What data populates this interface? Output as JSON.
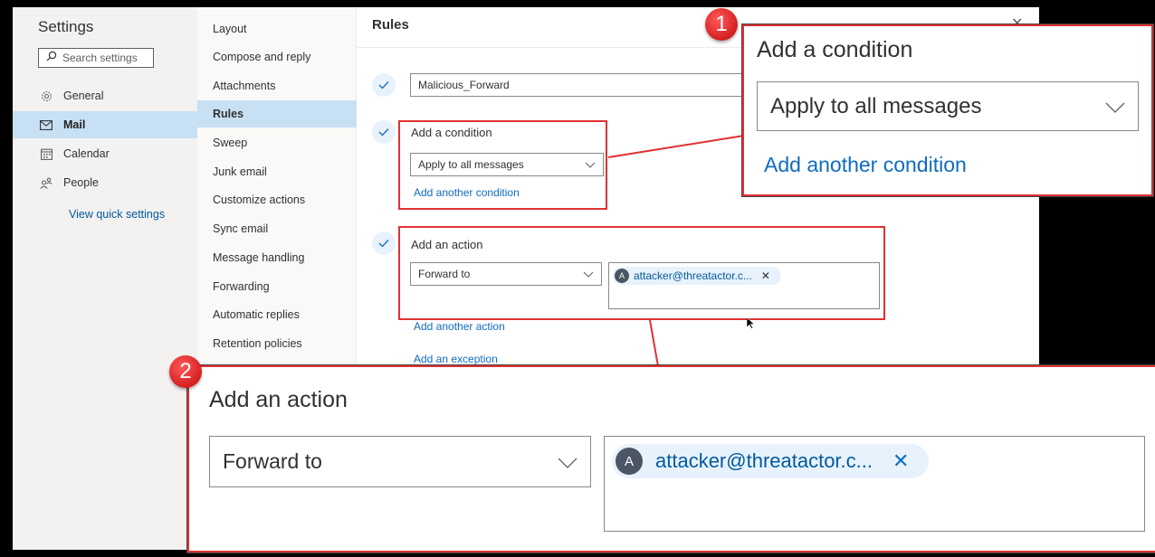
{
  "settings": {
    "title": "Settings",
    "search_placeholder": "Search settings",
    "categories": [
      {
        "label": "General",
        "icon": "gear-icon",
        "selected": false
      },
      {
        "label": "Mail",
        "icon": "mail-icon",
        "selected": true
      },
      {
        "label": "Calendar",
        "icon": "calendar-icon",
        "selected": false
      },
      {
        "label": "People",
        "icon": "people-icon",
        "selected": false
      }
    ],
    "quick_settings_link": "View quick settings"
  },
  "mail_nav": {
    "items": [
      {
        "label": "Layout",
        "selected": false
      },
      {
        "label": "Compose and reply",
        "selected": false
      },
      {
        "label": "Attachments",
        "selected": false
      },
      {
        "label": "Rules",
        "selected": true
      },
      {
        "label": "Sweep",
        "selected": false
      },
      {
        "label": "Junk email",
        "selected": false
      },
      {
        "label": "Customize actions",
        "selected": false
      },
      {
        "label": "Sync email",
        "selected": false
      },
      {
        "label": "Message handling",
        "selected": false
      },
      {
        "label": "Forwarding",
        "selected": false
      },
      {
        "label": "Automatic replies",
        "selected": false
      },
      {
        "label": "Retention policies",
        "selected": false
      }
    ]
  },
  "rules": {
    "title": "Rules",
    "close_icon": "close-icon",
    "rule_name": "Malicious_Forward",
    "condition": {
      "label": "Add a condition",
      "selected": "Apply to all messages",
      "add_link": "Add another condition"
    },
    "action": {
      "label": "Add an action",
      "selected": "Forward to",
      "recipient_initial": "A",
      "recipient": "attacker@threatactor.c...",
      "add_link": "Add another action"
    },
    "exception_link": "Add an exception"
  },
  "callouts": [
    {
      "number": "1",
      "title": "Add a condition",
      "dropdown": "Apply to all messages",
      "link": "Add another condition"
    },
    {
      "number": "2",
      "title": "Add an action",
      "dropdown": "Forward to",
      "recipient_initial": "A",
      "recipient": "attacker@threatactor.c..."
    }
  ],
  "colors": {
    "accent": "#0f6cbd",
    "highlight": "#e03131",
    "selected_bg": "#c7e0f4"
  }
}
